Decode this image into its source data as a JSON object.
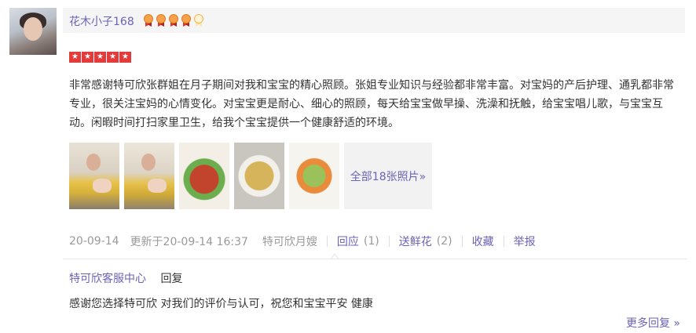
{
  "user": {
    "name": "花木小子168",
    "medals": 5,
    "medals_filled": 4
  },
  "rating": {
    "stars": 5,
    "star_glyph": "★"
  },
  "review": {
    "text": "非常感谢特可欣张群姐在月子期间对我和宝宝的精心照顾。张姐专业知识与经验都非常丰富。对宝妈的产后护理、通乳都非常专业，很关注宝妈的心情变化。对宝宝更是耐心、细心的照顾，每天给宝宝做早操、洗澡和抚触，给宝宝唱儿歌，与宝宝互动。闲暇时间打扫家里卫生，给我个宝宝提供一个健康舒适的环境。"
  },
  "photos": {
    "items": [
      "photo-1",
      "photo-2",
      "photo-3",
      "photo-4",
      "photo-5"
    ],
    "all_label": "全部18张照片»"
  },
  "meta": {
    "date": "20-09-14",
    "updated": "更新于20-09-14 16:37",
    "shop": "特可欣月嫂",
    "reply_label": "回应",
    "reply_count": "(1)",
    "flower_label": "送鲜花",
    "flower_count": "(2)",
    "favorite_label": "收藏",
    "report_label": "举报"
  },
  "reply": {
    "author": "特可欣客服中心",
    "verb": "回复",
    "text": "感谢您选择特可欣 对我们的评价与认可，祝您和宝宝平安 健康",
    "more_label": "更多回复 »"
  },
  "colors": {
    "link": "#6b63b5",
    "star": "#e33a3a",
    "meta": "#999999"
  }
}
